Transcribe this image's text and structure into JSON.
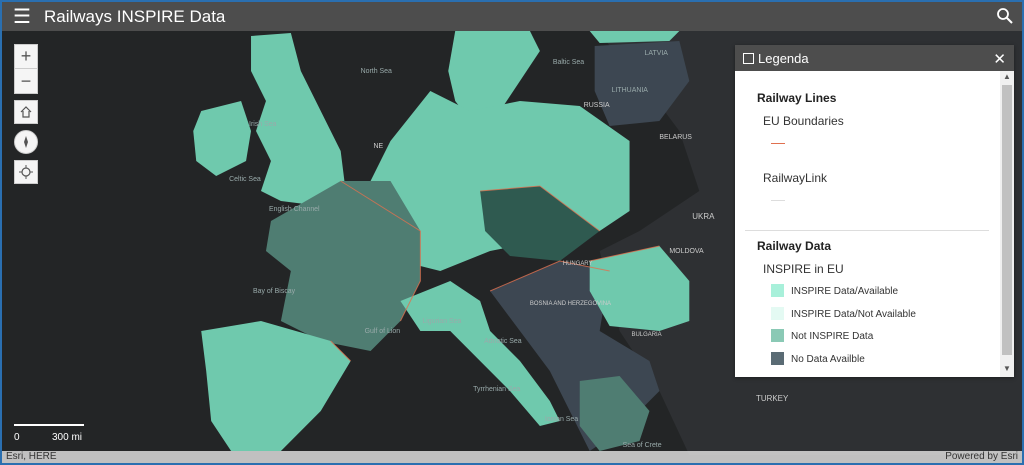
{
  "header": {
    "title": "Railways INSPIRE Data",
    "menu_icon": "hamburger-icon",
    "search_icon": "search-icon"
  },
  "map": {
    "controls": {
      "zoom_in": "+",
      "zoom_out": "−",
      "home_icon": "home-icon",
      "compass_icon": "compass-icon",
      "locate_icon": "locate-icon"
    },
    "scale": {
      "left": "0",
      "right": "300 mi"
    },
    "labels": {
      "north_sea": "North Sea",
      "irish_sea": "Irish Sea",
      "celtic_sea": "Celtic Sea",
      "english_channel": "English\nChannel",
      "bay_of_biscay": "Bay of Biscay",
      "baltic_sea": "Baltic Sea",
      "latvia": "LATVIA",
      "lithuania": "LITHUANIA",
      "russia": "RUSSIA",
      "belarus": "BELARUS",
      "ukraine": "UKRA",
      "moldova": "MOLDOVA",
      "hungary": "HUNGARY",
      "bosnia": "BOSNIA AND\nHERZEGOVINA",
      "bulgaria": "BULGARIA",
      "turkey": "TURKEY",
      "ligurian_sea": "Ligurian\nSea",
      "adriatic_sea": "Adriatic Sea",
      "tyrrhenian_sea": "Tyrrhenian\nSea",
      "ionian_sea": "Ionian Sea",
      "crete": "Sea of Crete",
      "gulf": "Gulf of\nLion",
      "ne": "NE"
    },
    "attribution_left": "Esri, HERE",
    "attribution_right": "Powered by Esri"
  },
  "legend": {
    "title": "Legenda",
    "close_icon": "close-icon",
    "section1_title": "Railway Lines",
    "eu_boundaries": "EU Boundaries",
    "railway_link": "RailwayLink",
    "section2_title": "Railway Data",
    "inspire_eu": "INSPIRE in EU",
    "items": [
      {
        "label": "INSPIRE Data/Available",
        "color": "#a8f0da"
      },
      {
        "label": "INSPIRE Data/Not Available",
        "color": "#e4faf3"
      },
      {
        "label": "Not INSPIRE Data",
        "color": "#8ac9b5"
      },
      {
        "label": "No Data Availble",
        "color": "#5a6b74"
      }
    ],
    "boundary_color": "#e0704f"
  }
}
